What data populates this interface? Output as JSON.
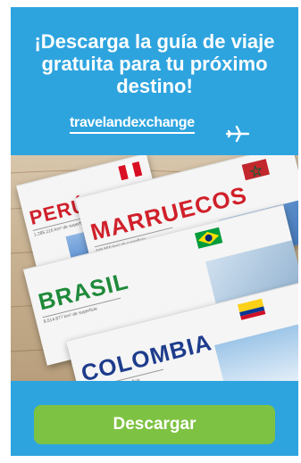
{
  "ad": {
    "headline": "¡Descarga la guía de viaje gratuita para tu próximo destino!",
    "brand": "travelandexchange",
    "cta_label": "Descargar",
    "colors": {
      "background": "#2ea4df",
      "button": "#7dc242",
      "text": "#ffffff"
    },
    "guides": [
      {
        "country": "PERÚ",
        "flag": "peru-flag"
      },
      {
        "country": "MARRUECOS",
        "flag": "morocco-flag"
      },
      {
        "country": "BRASIL",
        "flag": "brazil-flag"
      },
      {
        "country": "COLOMBIA",
        "flag": "colombia-flag"
      }
    ]
  }
}
